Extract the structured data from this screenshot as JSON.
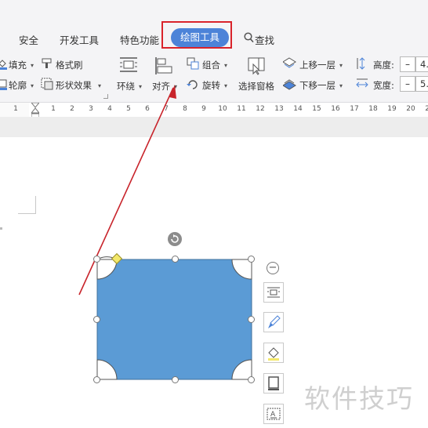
{
  "menu": {
    "items": [
      "安全",
      "开发工具",
      "特色功能"
    ],
    "active": "绘图工具",
    "search": "查找"
  },
  "ribbon": {
    "fill": "填充",
    "format_painter": "格式刷",
    "outline": "轮廓",
    "shape_effect": "形状效果",
    "wrap": "环绕",
    "align": "对齐",
    "group": "组合",
    "rotate": "旋转",
    "selection_pane": "选择窗格",
    "bring_forward": "上移一层",
    "send_backward": "下移一层",
    "height_label": "高度:",
    "height_value": "4.",
    "width_label": "宽度:",
    "width_value": "5.",
    "minus": "–"
  },
  "ruler": {
    "numbers": [
      "1",
      "1",
      "2",
      "3",
      "4",
      "5",
      "6",
      "7",
      "8",
      "9",
      "10",
      "11",
      "12",
      "13",
      "14",
      "15",
      "16",
      "17",
      "18",
      "19",
      "20",
      "21"
    ]
  },
  "shape": {
    "fill_color": "#5b9bd5",
    "border_color": "#41719c"
  },
  "watermark": "软件技巧",
  "colors": {
    "accent": "#4c83d8",
    "highlight": "#d9232b"
  }
}
